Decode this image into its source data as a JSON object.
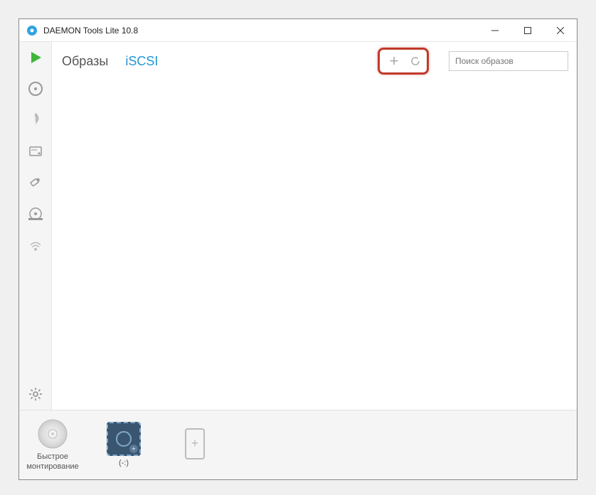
{
  "titlebar": {
    "title": "DAEMON Tools Lite 10.8"
  },
  "tabs": {
    "images": "Образы",
    "iscsi": "iSCSI"
  },
  "search": {
    "placeholder": "Поиск образов"
  },
  "bottom": {
    "quick_mount": "Быстрое монтирование",
    "drive_label": "(-:)"
  }
}
